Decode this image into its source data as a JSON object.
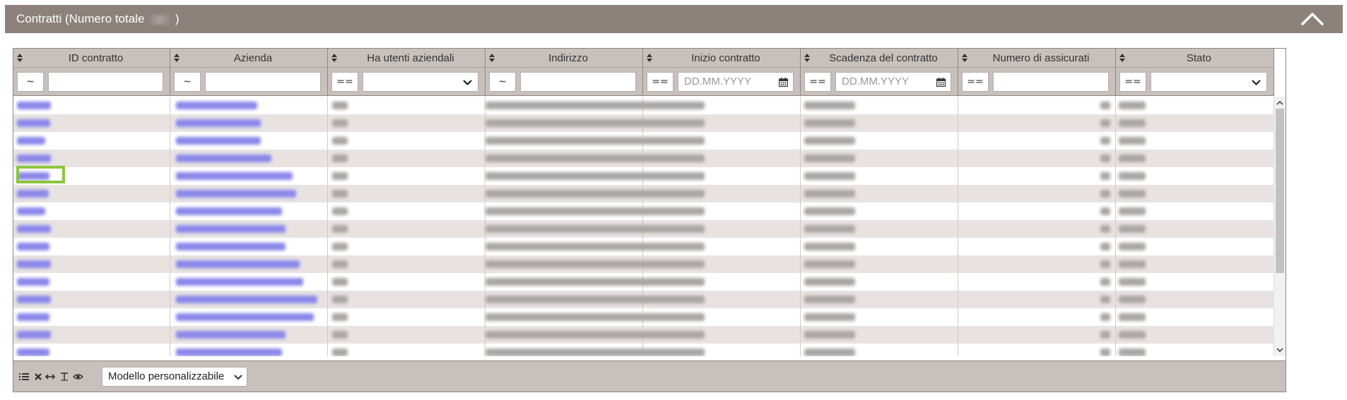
{
  "panel": {
    "title_prefix": "Contratti (Numero totale",
    "title_suffix": ")"
  },
  "columns": [
    {
      "label": "ID contratto",
      "filter_op": "~",
      "filter_type": "text",
      "placeholder": ""
    },
    {
      "label": "Azienda",
      "filter_op": "~",
      "filter_type": "text",
      "placeholder": ""
    },
    {
      "label": "Ha utenti aziendali",
      "filter_op": "==",
      "filter_type": "select",
      "placeholder": ""
    },
    {
      "label": "Indirizzo",
      "filter_op": "~",
      "filter_type": "text",
      "placeholder": ""
    },
    {
      "label": "Inizio contratto",
      "filter_op": "==",
      "filter_type": "date",
      "placeholder": "DD.MM.YYYY"
    },
    {
      "label": "Scadenza del contratto",
      "filter_op": "==",
      "filter_type": "date",
      "placeholder": "DD.MM.YYYY"
    },
    {
      "label": "Numero di assicurati",
      "filter_op": "==",
      "filter_type": "text",
      "placeholder": ""
    },
    {
      "label": "Stato",
      "filter_op": "==",
      "filter_type": "select",
      "placeholder": ""
    }
  ],
  "footer": {
    "icons": [
      "list-icon",
      "clear-icon",
      "resize-columns-icon",
      "text-format-icon",
      "eye-icon"
    ],
    "model_select_value": "Modello personalizzabile"
  },
  "colors": {
    "header_bar": "#8c817b",
    "grid_header": "#c8c0bd",
    "row_alt": "#e8e3e1",
    "link": "#8a87ea",
    "highlight": "#8cc63f"
  }
}
